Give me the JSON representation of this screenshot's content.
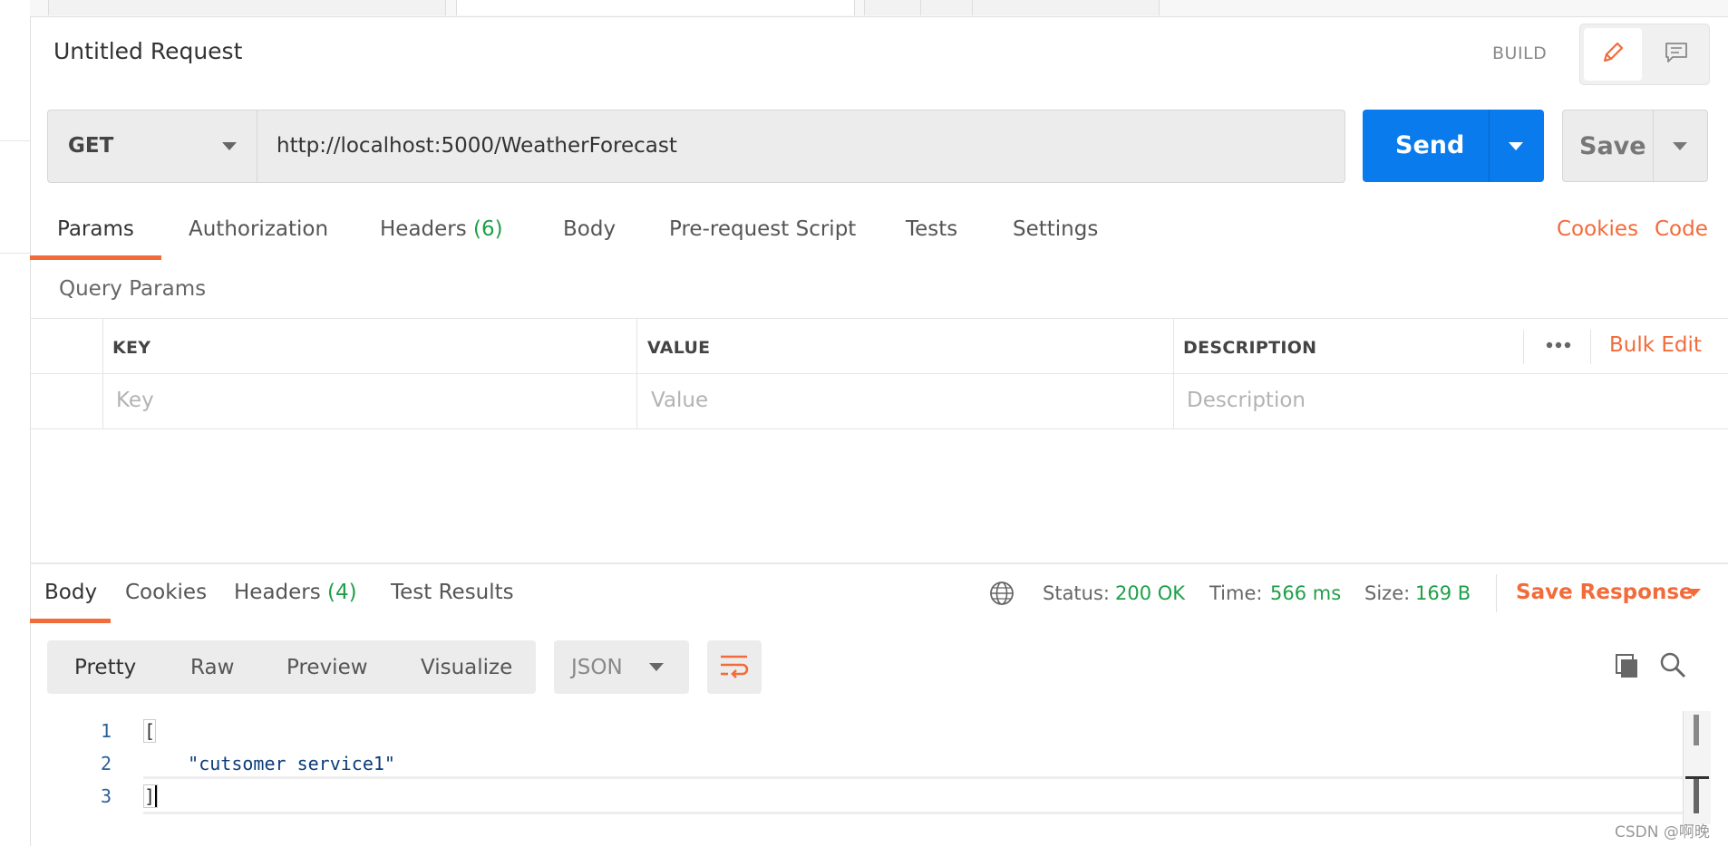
{
  "request": {
    "title": "Untitled Request",
    "build_label": "BUILD",
    "method": "GET",
    "url": "http://localhost:5000/WeatherForecast",
    "send_label": "Send",
    "save_label": "Save"
  },
  "request_tabs": [
    {
      "label": "Params",
      "active": true
    },
    {
      "label": "Authorization"
    },
    {
      "label": "Headers",
      "count": "(6)"
    },
    {
      "label": "Body"
    },
    {
      "label": "Pre-request Script"
    },
    {
      "label": "Tests"
    },
    {
      "label": "Settings"
    }
  ],
  "right_links": {
    "cookies": "Cookies",
    "code": "Code"
  },
  "query_params": {
    "heading": "Query Params",
    "columns": {
      "key": "KEY",
      "value": "VALUE",
      "description": "DESCRIPTION"
    },
    "bulk_edit": "Bulk Edit",
    "placeholders": {
      "key": "Key",
      "value": "Value",
      "description": "Description"
    }
  },
  "response_tabs": [
    {
      "label": "Body",
      "active": true
    },
    {
      "label": "Cookies"
    },
    {
      "label": "Headers",
      "count": "(4)"
    },
    {
      "label": "Test Results"
    }
  ],
  "response_status": {
    "status_label": "Status:",
    "status_value": "200 OK",
    "time_label": "Time:",
    "time_value": "566 ms",
    "size_label": "Size:",
    "size_value": "169 B",
    "save_response": "Save Response"
  },
  "view_modes": [
    "Pretty",
    "Raw",
    "Preview",
    "Visualize"
  ],
  "format": "JSON",
  "code_lines": [
    {
      "num": "1",
      "text": "["
    },
    {
      "num": "2",
      "text": "    \"cutsomer service1\""
    },
    {
      "num": "3",
      "text": "]"
    }
  ],
  "watermark": "CSDN @啊晚",
  "colors": {
    "accent": "#f26b3a",
    "send": "#097bed",
    "success": "#1e9f48"
  },
  "icons": [
    "pencil-icon",
    "comment-icon",
    "globe-icon",
    "wrap-icon",
    "copy-icon",
    "search-icon",
    "caret-down-icon",
    "more-icon"
  ]
}
